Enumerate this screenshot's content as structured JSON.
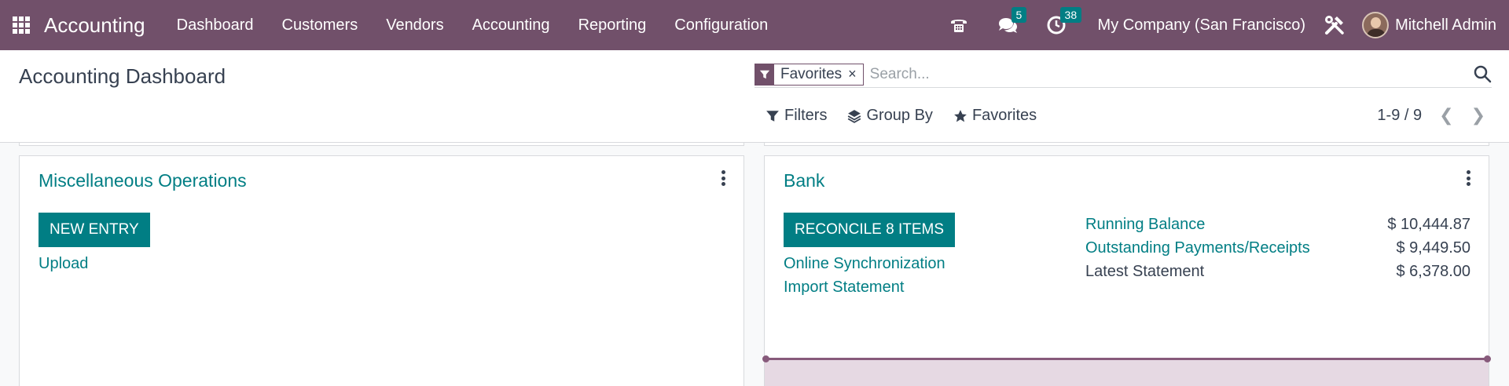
{
  "navbar": {
    "app_name": "Accounting",
    "menu": [
      "Dashboard",
      "Customers",
      "Vendors",
      "Accounting",
      "Reporting",
      "Configuration"
    ],
    "messages_count": "5",
    "activities_count": "38",
    "company": "My Company (San Francisco)",
    "user": "Mitchell Admin",
    "colors": {
      "navbar_bg": "#71506a",
      "accent": "#017e84"
    }
  },
  "control_panel": {
    "title": "Accounting Dashboard",
    "facet_label": "Favorites",
    "facet_remove": "×",
    "search_placeholder": "Search...",
    "filters_label": "Filters",
    "group_by_label": "Group By",
    "favorites_label": "Favorites",
    "pager_value": "1-9 / 9"
  },
  "cards": {
    "misc": {
      "title": "Miscellaneous Operations",
      "primary_button": "NEW ENTRY",
      "upload_link": "Upload"
    },
    "bank": {
      "title": "Bank",
      "primary_button": "RECONCILE 8 ITEMS",
      "online_sync_link": "Online Synchronization",
      "import_link": "Import Statement",
      "stats": [
        {
          "label": "Running Balance",
          "value": "$ 10,444.87"
        },
        {
          "label": "Outstanding Payments/Receipts",
          "value": "$ 9,449.50"
        },
        {
          "label": "Latest Statement",
          "value": "$ 6,378.00"
        }
      ]
    }
  }
}
